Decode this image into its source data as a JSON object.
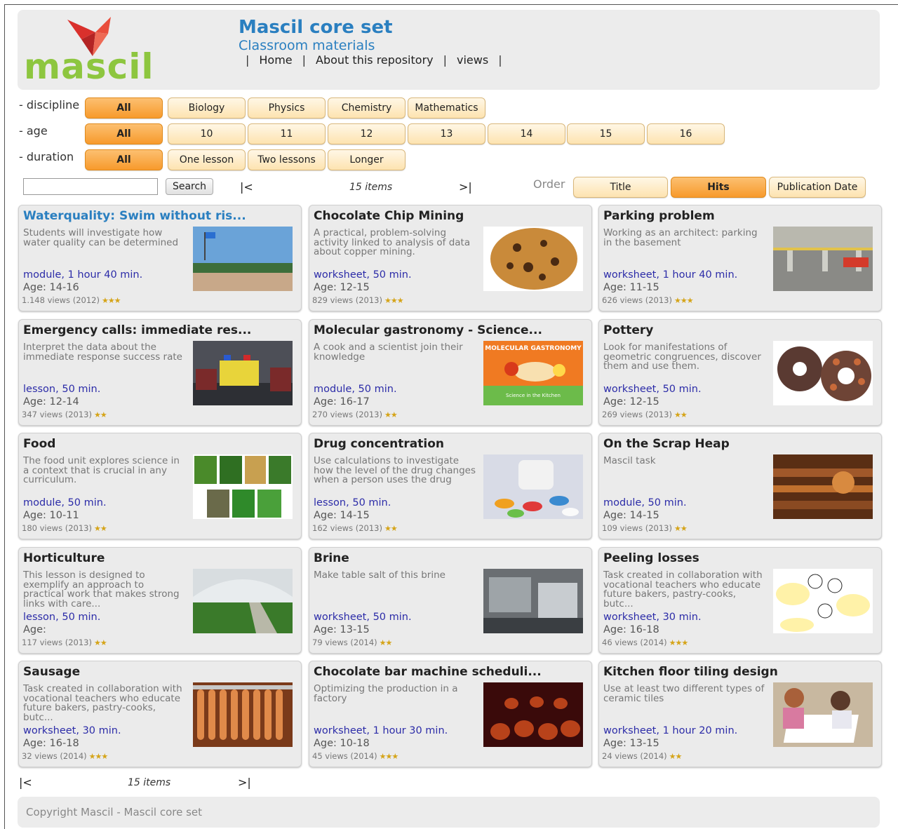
{
  "brand": {
    "logo_text": "mascil",
    "title": "Mascil core set",
    "subtitle": "Classroom materials"
  },
  "topnav": {
    "sep": "|",
    "items": [
      "Home",
      "About this repository",
      "views"
    ]
  },
  "filters": {
    "discipline": {
      "label": "- discipline",
      "options": [
        "All",
        "Biology",
        "Physics",
        "Chemistry",
        "Mathematics"
      ]
    },
    "age": {
      "label": "- age",
      "options": [
        "All",
        "10",
        "11",
        "12",
        "13",
        "14",
        "15",
        "16"
      ]
    },
    "duration": {
      "label": "- duration",
      "options": [
        "All",
        "One lesson",
        "Two lessons",
        "Longer"
      ]
    }
  },
  "search": {
    "button": "Search",
    "value": ""
  },
  "pager": {
    "first": "|<",
    "last": ">|",
    "count": "15 items"
  },
  "order": {
    "label": "Order",
    "options": [
      "Title",
      "Hits",
      "Publication Date"
    ],
    "active": "Hits"
  },
  "cards": [
    {
      "title": "Waterquality: Swim without ris...",
      "desc": "Students will investigate how water quality can be determined",
      "type": "module, 1 hour 40 min.",
      "age": "Age: 14-16",
      "views": "1.148 views (2012)",
      "stars": "★★★",
      "thumb": "beach-photo"
    },
    {
      "title": "Chocolate Chip Mining",
      "desc": "A practical, problem-solving activity linked to analysis of data about copper mining.",
      "type": "worksheet, 50 min.",
      "age": "Age: 12-15",
      "views": "829 views (2013)",
      "stars": "★★★",
      "thumb": "cookie-photo"
    },
    {
      "title": "Parking problem",
      "desc": "Working as an architect: parking in the basement",
      "type": "worksheet, 1 hour 40 min.",
      "age": "Age: 11-15",
      "views": "626 views (2013)",
      "stars": "★★★",
      "thumb": "parking-photo"
    },
    {
      "title": "Emergency calls: immediate res...",
      "desc": "Interpret the data about the immediate response success rate",
      "type": "lesson, 50 min.",
      "age": "Age: 12-14",
      "views": "347 views (2013)",
      "stars": "★★",
      "thumb": "ambulance-photo"
    },
    {
      "title": "Molecular gastronomy - Science...",
      "desc": "A cook and a scientist join their knowledge",
      "type": "module, 50 min.",
      "age": "Age: 16-17",
      "views": "270 views (2013)",
      "stars": "★★",
      "thumb": "gastronomy-photo",
      "thumb_caption": "MOLECULAR GASTRONOMY",
      "thumb_subcaption": "Science in the Kitchen"
    },
    {
      "title": "Pottery",
      "desc": "Look for manifestations of geometric congruences, discover them and use them.",
      "type": "worksheet, 50 min.",
      "age": "Age: 12-15",
      "views": "269 views (2013)",
      "stars": "★★",
      "thumb": "pottery-photo"
    },
    {
      "title": "Food",
      "desc": "The food unit explores science in a context that is crucial in any curriculum.",
      "type": "module, 50 min.",
      "age": "Age: 10-11",
      "views": "180 views (2013)",
      "stars": "★★",
      "thumb": "food-photo"
    },
    {
      "title": "Drug concentration",
      "desc": "Use calculations to investigate how the level of the drug changes when a person uses the drug",
      "type": "lesson, 50 min.",
      "age": "Age: 14-15",
      "views": "162 views (2013)",
      "stars": "★★",
      "thumb": "pills-photo"
    },
    {
      "title": "On the Scrap Heap",
      "desc": "Mascil task",
      "type": "module, 50 min.",
      "age": "Age: 14-15",
      "views": "109 views (2013)",
      "stars": "★★",
      "thumb": "scrap-photo"
    },
    {
      "title": "Horticulture",
      "desc": "This lesson is designed to exemplify an approach to practical work that makes strong links with care...",
      "type": "lesson, 50 min.",
      "age": "Age:",
      "views": "117 views (2013)",
      "stars": "★★",
      "thumb": "greenhouse-photo"
    },
    {
      "title": "Brine",
      "desc": "Make table salt of this brine",
      "type": "worksheet, 50 min.",
      "age": "Age: 13-15",
      "views": "79 views (2014)",
      "stars": "★★",
      "thumb": "brine-photo"
    },
    {
      "title": "Peeling losses",
      "desc": "Task created in collaboration with vocational teachers who educate future bakers, pastry-cooks, butc...",
      "type": "worksheet, 30 min.",
      "age": "Age: 16-18",
      "views": "46 views (2014)",
      "stars": "★★★",
      "thumb": "cartoon-photo"
    },
    {
      "title": "Sausage",
      "desc": "Task created in collaboration with vocational teachers who educate future bakers, pastry-cooks, butc...",
      "type": "worksheet, 30 min.",
      "age": "Age: 16-18",
      "views": "32 views (2014)",
      "stars": "★★★",
      "thumb": "sausage-photo"
    },
    {
      "title": "Chocolate bar machine scheduli...",
      "desc": "Optimizing the production in a factory",
      "type": "worksheet, 1 hour 30 min.",
      "age": "Age: 10-18",
      "views": "45 views (2014)",
      "stars": "★★★",
      "thumb": "chocolate-machine-photo"
    },
    {
      "title": "Kitchen floor tiling design",
      "desc": "Use at least two different types of ceramic tiles",
      "type": "worksheet, 1 hour 20 min.",
      "age": "Age: 13-15",
      "views": "24 views (2014)",
      "stars": "★★",
      "thumb": "tiling-photo"
    }
  ],
  "footer": {
    "text": "Copyright Mascil - Mascil core set"
  }
}
